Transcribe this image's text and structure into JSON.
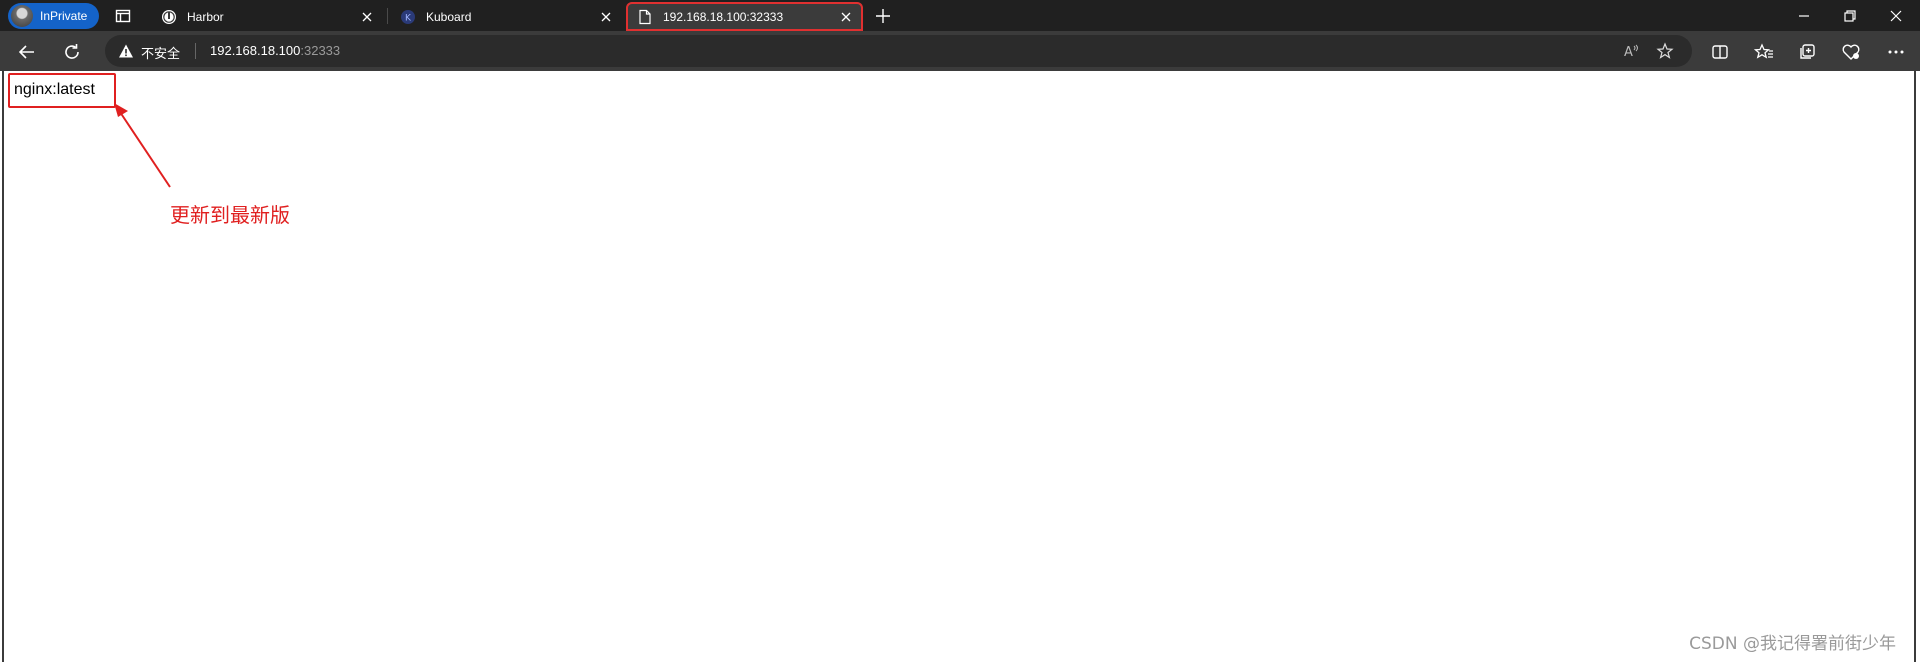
{
  "browser": {
    "profile_label": "InPrivate",
    "tabs": [
      {
        "title": "Harbor",
        "favicon": "harbor-icon"
      },
      {
        "title": "Kuboard",
        "favicon": "kuboard-icon"
      },
      {
        "title": "192.168.18.100:32333",
        "favicon": "page-icon"
      }
    ],
    "address": {
      "security_label": "不安全",
      "host": "192.168.18.100",
      "port": ":32333"
    }
  },
  "page": {
    "content_text": "nginx:latest"
  },
  "annotation": {
    "text": "更新到最新版",
    "color": "#e02020"
  },
  "watermark": {
    "text": "CSDN @我记得署前街少年"
  },
  "colors": {
    "tabstrip_bg": "#202020",
    "toolbar_bg": "#3b3b3b",
    "profile_bg": "#1463c9",
    "highlight": "#e02020"
  }
}
